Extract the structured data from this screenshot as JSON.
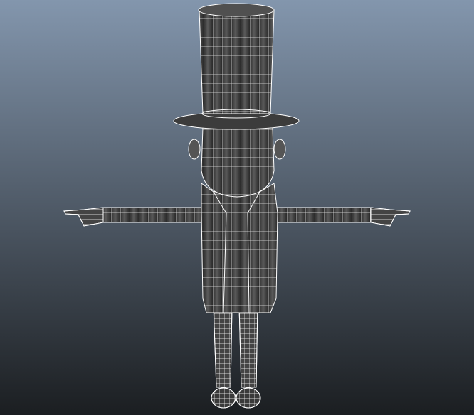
{
  "viewport": {
    "background_top": "#8396ad",
    "background_bottom": "#1b1e21",
    "model_fill": "#4a4a4a",
    "wire_color": "#ffffff"
  },
  "model": {
    "parts": [
      "top-hat",
      "hat-brim",
      "head",
      "ears",
      "coat",
      "arms",
      "hands",
      "legs",
      "shoes"
    ]
  }
}
